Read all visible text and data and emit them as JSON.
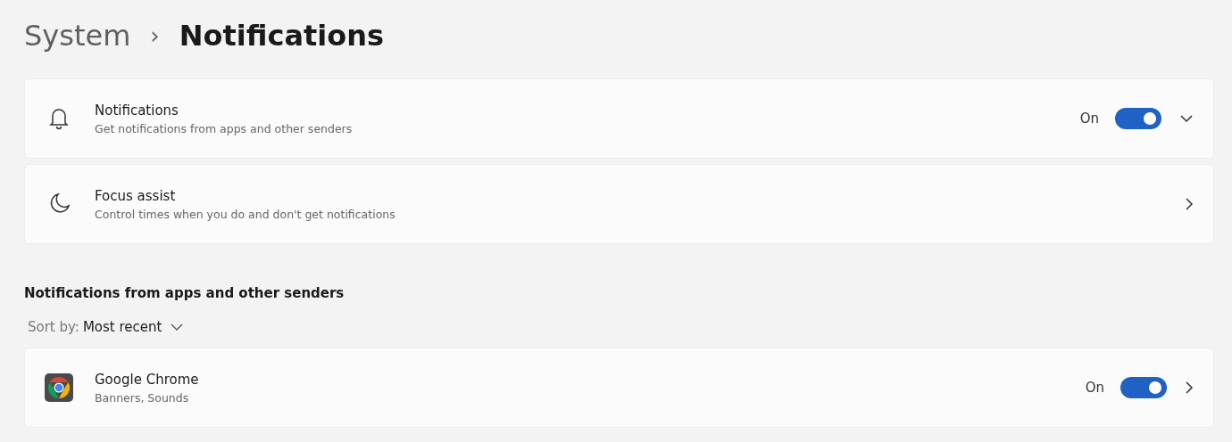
{
  "breadcrumb": {
    "parent": "System",
    "separator": "›",
    "current": "Notifications"
  },
  "settings": [
    {
      "kind": "expandable",
      "title": "Notifications",
      "subtitle": "Get notifications from apps and other senders",
      "toggle": {
        "label": "On",
        "on": true
      }
    },
    {
      "kind": "link",
      "title": "Focus assist",
      "subtitle": "Control times when you do and don't get notifications"
    }
  ],
  "section": {
    "heading": "Notifications from apps and other senders",
    "sort_label": "Sort by:",
    "sort_value": "Most recent"
  },
  "apps": [
    {
      "kind": "link",
      "title": "Google Chrome",
      "subtitle": "Banners, Sounds",
      "toggle": {
        "label": "On",
        "on": true
      }
    }
  ]
}
